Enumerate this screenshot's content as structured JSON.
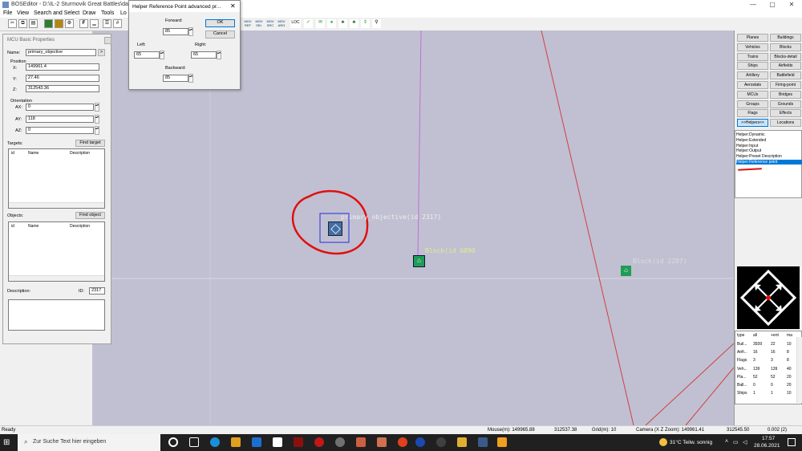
{
  "window": {
    "title": "BOSEditor - D:\\IL-2 Sturmovik Great Battles\\data\\",
    "controls": [
      "—",
      "▢",
      "✕"
    ]
  },
  "menu": [
    "File",
    "View",
    "Search and Select",
    "Draw",
    "Tools",
    "Lo"
  ],
  "toolbar": {
    "text_buttons": [
      "F",
      "LOC"
    ],
    "word_buttons": [
      "MOV\nREF",
      "MOV\nSEL",
      "MOV\nSRC",
      "MOV\nARG"
    ]
  },
  "dialog": {
    "title": "Helper Reference Point advanced pr...",
    "forward_label": "Forward:",
    "forward_value": "85",
    "left_label": "Left:",
    "left_value": "65",
    "right_label": "Right:",
    "right_value": "65",
    "backward_label": "Backward:",
    "backward_value": "85",
    "ok": "OK",
    "cancel": "Cancel"
  },
  "mcu": {
    "header": "MCU Basic Properties",
    "name_label": "Name:",
    "name_value": "primary_objective",
    "name_button": ">",
    "position_label": "Position",
    "x_label": "X:",
    "x_value": "149961.4",
    "y_label": "Y:",
    "y_value": "27.46",
    "z_label": "Z:",
    "z_value": "312543.36",
    "orientation_label": "Orientation",
    "ax_label": "AX:",
    "ax_value": "0",
    "ay_label": "AY:",
    "ay_value": "118",
    "az_label": "AZ:",
    "az_value": "0",
    "targets_label": "Targets:",
    "find_target": "Find target",
    "objects_label": "Objects:",
    "find_object": "Find object",
    "col_id": "id",
    "col_name": "Name",
    "col_desc": "Description",
    "description_label": "Description:",
    "id_label": "ID:",
    "id_value": "2317"
  },
  "map": {
    "object_label": "primary_objective(id 2317)",
    "block_label_1": "Block(id 6890",
    "block_label_2": "Block(id 2287)",
    "colors": {
      "background": "#c0c0d2",
      "selection": "#2a2ae0",
      "annotation": "#e01010"
    }
  },
  "right": {
    "buttons": [
      [
        "Planes",
        "Buildings"
      ],
      [
        "Vehicles",
        "Blocks"
      ],
      [
        "Trains",
        "Blocks-detail"
      ],
      [
        "Ships",
        "Airfields"
      ],
      [
        "Artillery",
        "Battlefield"
      ],
      [
        "Aerostats",
        "Firing-point"
      ],
      [
        "MCUs",
        "Bridges"
      ],
      [
        "Groups",
        "Grounds"
      ],
      [
        "Flags",
        "Effects"
      ],
      [
        ">>Helpers<<",
        "Locations"
      ]
    ],
    "helpers": [
      "Helper:Dynamic",
      "Helper:Extended",
      "Helper:Input",
      "Helper:Output",
      "Helper:Preset Description",
      "Helper:Reference point"
    ],
    "selected_helper": 5,
    "stats_header": [
      "type",
      "all",
      "+ent",
      "ma"
    ],
    "stats_rows": [
      [
        "Buil...",
        "3939",
        "22",
        "10"
      ],
      [
        "Airfi...",
        "16",
        "16",
        "8"
      ],
      [
        "Flags",
        "3",
        "3",
        "8"
      ],
      [
        "Veh...",
        "139",
        "139",
        "40"
      ],
      [
        "Pla...",
        "52",
        "52",
        "20"
      ],
      [
        "Ball...",
        "0",
        "0",
        "20"
      ],
      [
        "Ships",
        "1",
        "1",
        "10"
      ],
      [
        "",
        "",
        "",
        ""
      ]
    ]
  },
  "status": {
    "ready": "Ready",
    "mouse": "Mouse(m):   149965.88",
    "mouse2": "312537.38",
    "grid": "Grid(m):   10",
    "camera": "Camera (X  Z  Zoom):   149961.41",
    "camera2": "312545.50",
    "zoom": "0.002 (2)"
  },
  "taskbar": {
    "search_placeholder": "Zur Suche Text hier eingeben",
    "weather": "31°C  Teilw. sonnig",
    "time": "17:57",
    "date": "28.06.2021"
  }
}
